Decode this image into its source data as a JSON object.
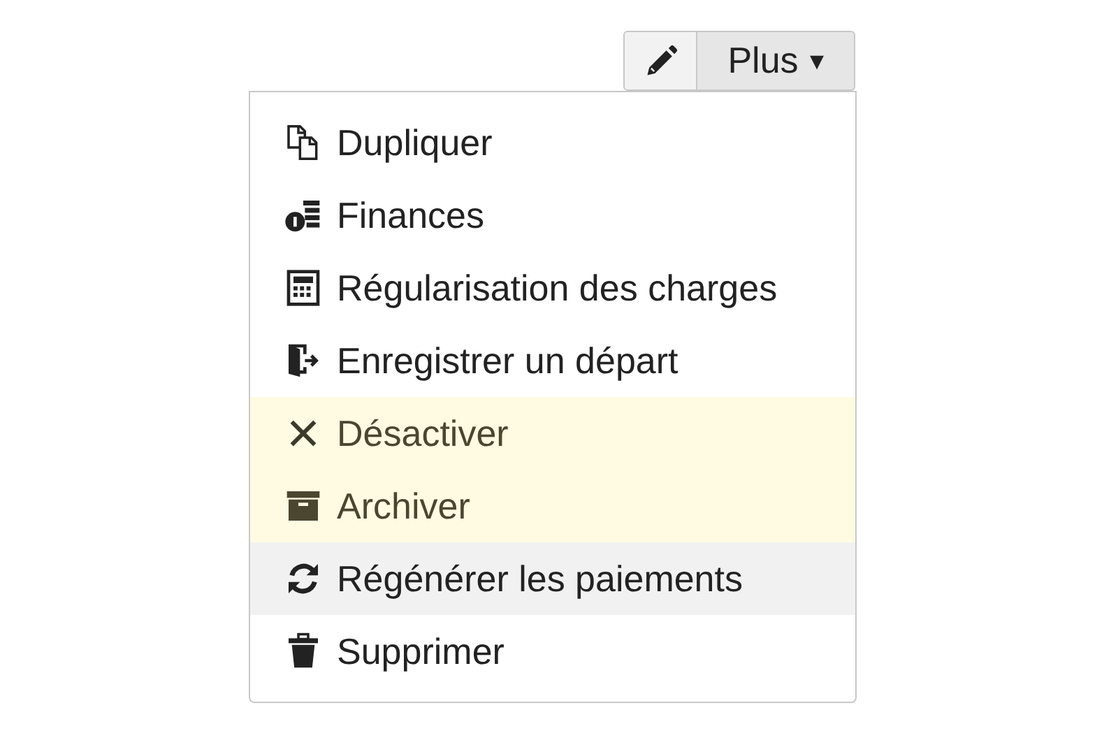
{
  "toolbar": {
    "more_button": {
      "label": "Plus",
      "caret": "▾"
    }
  },
  "menu": {
    "items": [
      {
        "label": "Dupliquer",
        "warning": false,
        "hovered": false
      },
      {
        "label": "Finances",
        "warning": false,
        "hovered": false
      },
      {
        "label": "Régularisation des charges",
        "warning": false,
        "hovered": false
      },
      {
        "label": "Enregistrer un départ",
        "warning": false,
        "hovered": false
      },
      {
        "label": "Désactiver",
        "warning": true,
        "hovered": false
      },
      {
        "label": "Archiver",
        "warning": true,
        "hovered": false
      },
      {
        "label": "Régénérer les paiements",
        "warning": false,
        "hovered": true
      },
      {
        "label": "Supprimer",
        "warning": false,
        "hovered": false
      }
    ]
  }
}
